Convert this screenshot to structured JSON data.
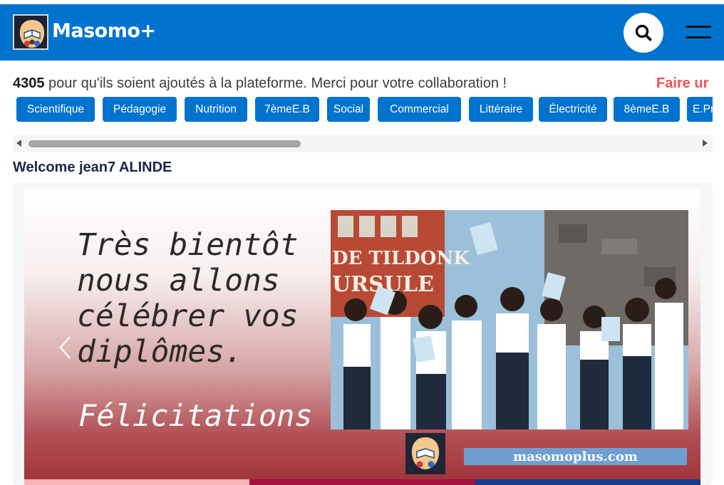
{
  "header": {
    "brand": "Masomo+",
    "colors": {
      "bar": "#0073cf",
      "text": "#ffffff"
    },
    "search_icon": "search-icon",
    "menu_icon": "menu-icon"
  },
  "ticker": {
    "number": "4305",
    "text": " pour qu'ils soient ajoutés à la plateforme. Merci pour votre collaboration !",
    "cta": "Faire ur"
  },
  "categories": [
    "Scientifique",
    "Pédagogie",
    "Nutrition",
    "7èmeE.B",
    "Social",
    "Commercial",
    "Littéraire",
    "Électricité",
    "8èmeE.B",
    "E.Pr"
  ],
  "welcome": "Welcome jean7 ALINDE",
  "carousel": {
    "headline": "Très bientôt\nnous allons\ncélébrer vos\ndiplômes.",
    "subline": "Félicitations",
    "photo_sign": [
      "DE TILDONK",
      "URSULE"
    ],
    "site": "masomoplus.com",
    "indicator_colors": [
      "#f5b5b5",
      "#a3123f",
      "#143e8f"
    ]
  }
}
